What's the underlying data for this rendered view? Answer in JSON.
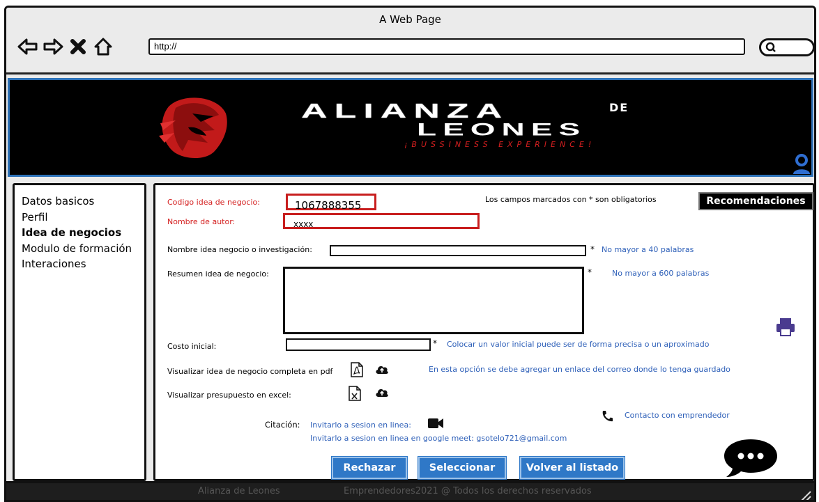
{
  "browser": {
    "title": "A Web Page",
    "url": "http://"
  },
  "banner": {
    "brand_top": "ALIANZA",
    "brand_de": "DE",
    "brand_bottom": "LEONES",
    "tagline": "¡BUSSINESS EXPERIENCE!"
  },
  "sidebar": {
    "items": [
      {
        "label": "Datos basicos"
      },
      {
        "label": "Perfil"
      },
      {
        "label": "Idea de negocios"
      },
      {
        "label": "Modulo de formación"
      },
      {
        "label": "Interaciones"
      }
    ]
  },
  "form": {
    "code_label": "Codigo idea de negocio:",
    "code_value": "1067888355",
    "author_label": "Nombre de autor:",
    "author_value": "xxxx",
    "required_note": "Los campos marcados con * son obligatorios",
    "recommendations": "Recomendaciones",
    "name_label": "Nombre idea negocio o investigación:",
    "name_hint": "No mayor a 40 palabras",
    "summary_label": "Resumen idea de negocio:",
    "summary_hint": "No mayor a 600 palabras",
    "cost_label": "Costo inicial:",
    "cost_hint": "Colocar un valor inicial puede ser de forma precisa o un aproximado",
    "pdf_label": "Visualizar idea de negocio completa en pdf",
    "pdf_hint": "En esta opción se debe agregar un enlace del correo donde lo tenga guardado",
    "excel_label": "Visualizar presupuesto en excel:",
    "asterisk": "*",
    "citation_label": "Citación:",
    "invite_online": "Invitarlo a sesion en linea:",
    "invite_meet": "Invitarlo a sesion en linea en google meet:  gsotelo721@gmail.com",
    "contact": "Contacto con emprendedor"
  },
  "actions": {
    "reject": "Rechazar",
    "select": "Seleccionar",
    "back": "Volver al listado"
  },
  "footer": {
    "left": "Alianza de Leones",
    "right": "Emprendedores2021 @  Todos los derechos reservados"
  },
  "colors": {
    "accent_blue": "#2f78c7",
    "error_red": "#c81e1e",
    "banner_bg": "#000000",
    "hint_blue": "#2d5fb8",
    "icon_purple": "#4a3b8f"
  },
  "icons": [
    "back-arrow-icon",
    "forward-arrow-icon",
    "close-icon",
    "home-icon",
    "search-icon",
    "lion-logo-icon",
    "user-icon",
    "print-icon",
    "pdf-file-icon",
    "cloud-upload-icon",
    "excel-file-icon",
    "video-camera-icon",
    "phone-icon",
    "chat-bubble-icon"
  ]
}
